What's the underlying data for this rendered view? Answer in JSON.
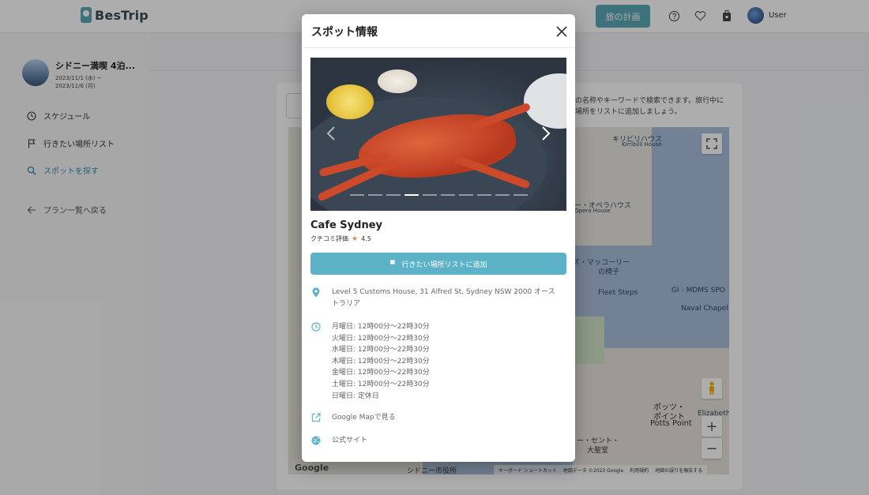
{
  "header": {
    "logo_text": "BesTrip",
    "plan_button": "旅の計画",
    "user_name": "User"
  },
  "sidebar": {
    "trip_title": "シドニー満喫 4泊...",
    "trip_date_start": "2023/11/1 (水) ~",
    "trip_date_end": "2023/11/6 (月)",
    "nav": [
      {
        "label": "スケジュール"
      },
      {
        "label": "行きたい場所リスト"
      },
      {
        "label": "スポットを探す"
      },
      {
        "label": "プラン一覧へ戻る"
      }
    ]
  },
  "main": {
    "description_line1": "の名称やキーワードで検索できます。旅行中に",
    "description_line2": "場所をリストに追加しましょう。"
  },
  "map": {
    "labels": [
      {
        "text": "キリビリハウス"
      },
      {
        "text": "Kirribilli House"
      },
      {
        "text": "ー・オペラハウス"
      },
      {
        "text": "Opera House"
      },
      {
        "text": "ズ・マッコーリー"
      },
      {
        "text": "の椅子"
      },
      {
        "text": "Fleet Steps"
      },
      {
        "text": "GI - MDMS SPO"
      },
      {
        "text": "Naval Chapel"
      },
      {
        "text": "ポッツ・"
      },
      {
        "text": "ポイント"
      },
      {
        "text": "Potts Point"
      },
      {
        "text": "Elizabeth"
      },
      {
        "text": "シドニー市役所"
      },
      {
        "text": "ー・セント・"
      },
      {
        "text": "大聖堂"
      }
    ],
    "google_logo": "Google",
    "footer": [
      "キーボード ショートカット",
      "地図データ ©2023 Google",
      "利用規約",
      "地図の誤りを報告する"
    ]
  },
  "modal": {
    "title": "スポット情報",
    "spot_name": "Cafe Sydney",
    "rating_label": "クチコミ評価",
    "rating_value": "4.5",
    "add_button": "行きたい場所リストに追加",
    "address": "Level 5 Customs House, 31 Alfred St, Sydney NSW 2000 オーストラリア",
    "hours": [
      "月曜日: 12時00分～22時30分",
      "火曜日: 12時00分～22時30分",
      "水曜日: 12時00分～22時30分",
      "木曜日: 12時00分～22時30分",
      "金曜日: 12時00分～22時30分",
      "土曜日: 12時00分～22時30分",
      "日曜日: 定休日"
    ],
    "google_map_link": "Google Mapで見る",
    "official_site_link": "公式サイト",
    "carousel": {
      "total_images": 10,
      "active_index": 3
    }
  },
  "colors": {
    "accent": "#5aa9b8",
    "button": "#5cb3c8",
    "active_nav": "#3f8fb2",
    "star": "#e8833a"
  }
}
